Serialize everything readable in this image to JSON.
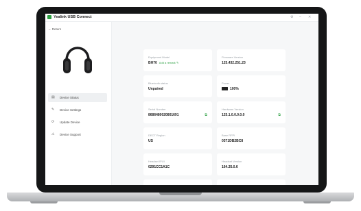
{
  "window": {
    "title": "Yealink USB Connect",
    "controls": [
      "⚙",
      "–",
      "✕"
    ]
  },
  "sidebar": {
    "return_label": "Return",
    "items": [
      {
        "label": "Device Status",
        "icon": "device-status-icon",
        "glyph": "▤",
        "active": true
      },
      {
        "label": "Device Settings",
        "icon": "settings-icon",
        "glyph": "✎",
        "active": false
      },
      {
        "label": "Update Device",
        "icon": "update-icon",
        "glyph": "⟳",
        "active": false
      },
      {
        "label": "Device Support",
        "icon": "support-icon",
        "glyph": "⚠",
        "active": false
      }
    ]
  },
  "fields": {
    "equipment_model": {
      "label": "Equipment Model",
      "value": "BH70",
      "link": "Add a remark"
    },
    "firmware_version": {
      "label": "Firmware Version",
      "value": "125.432.251.23"
    },
    "bluetooth_status": {
      "label": "Bluetooth status",
      "value": "Unpaired"
    },
    "power": {
      "label": "Power",
      "value": "100%"
    },
    "serial_number": {
      "label": "Serial Number",
      "value": "8686480020801691"
    },
    "hardware_version": {
      "label": "Hardware Version",
      "value": "125.1.0.0.0.0.0"
    },
    "dect_region": {
      "label": "DECT Region",
      "value": "US"
    },
    "base_rfpi": {
      "label": "Base RFPI",
      "value": "0371DB2BC8"
    },
    "headset_ipui": {
      "label": "Headset IPUI",
      "value": "0291CC1A1C"
    },
    "headset_version": {
      "label": "Headset Version",
      "value": "164.35.0.6"
    }
  },
  "colors": {
    "accent": "#2ea043",
    "bezel": "#151617",
    "screen_bg": "#f6f7f8"
  }
}
